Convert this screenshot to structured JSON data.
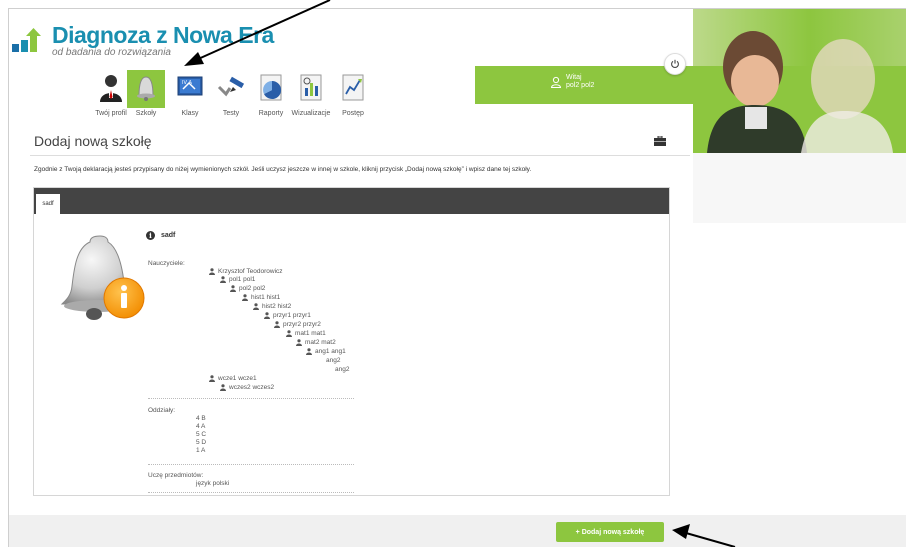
{
  "logo": {
    "title": "Diagnoza z Nowa Era",
    "subtitle": "od badania do rozwiązania"
  },
  "user": {
    "greeting": "Witaj",
    "name": "pol2 pol2"
  },
  "nav": [
    {
      "label": "Twój profil",
      "icon": "person-icon"
    },
    {
      "label": "Szkoły",
      "icon": "bell-icon"
    },
    {
      "label": "Klasy",
      "icon": "class-board-icon"
    },
    {
      "label": "Testy",
      "icon": "test-checkmark-icon"
    },
    {
      "label": "Raporty",
      "icon": "report-pie-icon"
    },
    {
      "label": "Wizualizacje",
      "icon": "visualization-chart-icon"
    },
    {
      "label": "Postęp",
      "icon": "progress-line-icon"
    }
  ],
  "page": {
    "title": "Dodaj nową szkołę",
    "info": "Zgodnie z Twoją deklaracją jesteś przypisany do niżej wymienionych szkół. Jeśli uczysz jeszcze w innej w szkole, kliknij przycisk „Dodaj nową szkołę” i wpisz dane tej szkoły."
  },
  "panel": {
    "tab": "sadf",
    "school_name": "sadf",
    "teachers_label": "Nauczyciele:",
    "teachers": [
      "Krzysztof Teodorowicz",
      "pol1 pol1",
      "pol2 pol2",
      "hist1 hist1",
      "hist2 hist2",
      "przyr1 przyr1",
      "przyr2 przyr2",
      "mat1 mat1",
      "mat2 mat2",
      "ang1 ang1",
      "ang2",
      "ang2",
      "wcze1 wcze1",
      "wczes2 wczes2"
    ],
    "classes_label": "Oddziały:",
    "classes": [
      "4 B",
      "4 A",
      "5 C",
      "5 D",
      "1 A"
    ],
    "subjects_label": "Uczę przedmiotów:",
    "subjects": [
      "język polski"
    ]
  },
  "add_button": "+ Dodaj nową szkołę",
  "colors": {
    "accent": "#8dc63f",
    "dark": "#444444",
    "brand": "#1a8fb0"
  }
}
